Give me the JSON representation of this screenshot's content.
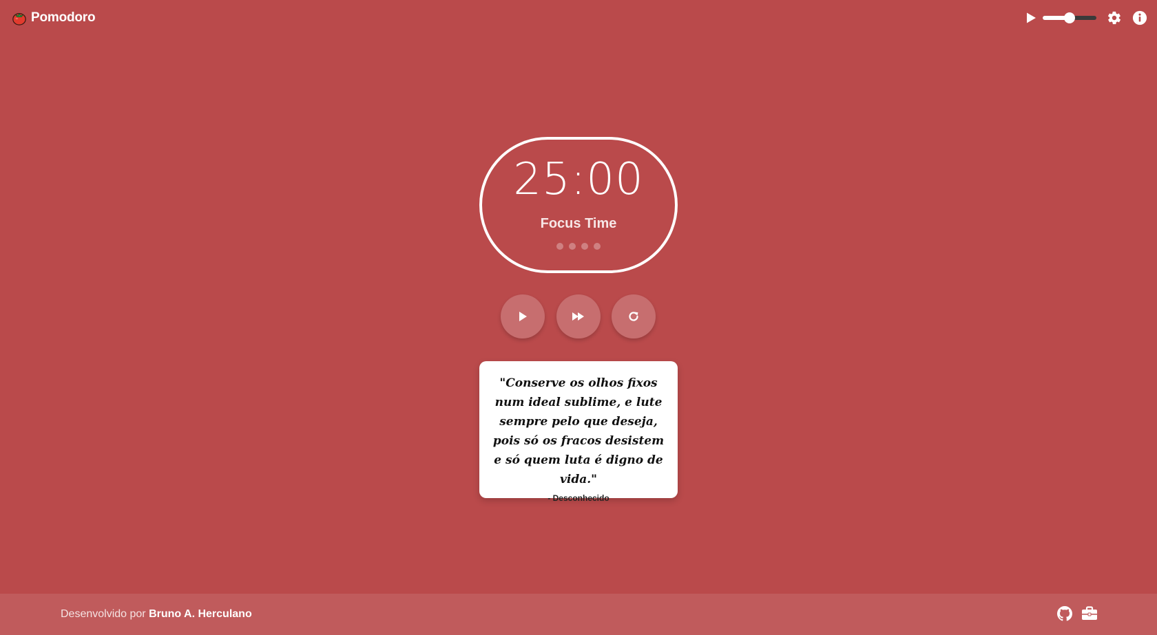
{
  "header": {
    "brand_name": "Pomodoro",
    "logo_icon": "tomato-icon",
    "music_play_icon": "play-icon",
    "volume_level": 0.5,
    "settings_icon": "gear-icon",
    "info_icon": "info-icon"
  },
  "timer": {
    "time": "25:00",
    "mode_label": "Focus Time",
    "cycle_dots_total": 4,
    "cycle_dots_completed": 0
  },
  "controls": {
    "start_icon": "play-icon",
    "skip_icon": "fast-forward-icon",
    "reset_icon": "reset-icon"
  },
  "quote": {
    "text": "\"Conserve os olhos fixos num ideal sublime, e lute sempre pelo que deseja, pois só os fracos desistem e só quem luta é digno de vida.\"",
    "author": "- Desconhecido"
  },
  "footer": {
    "credit_prefix": "Desenvolvido por",
    "credit_name": "Bruno A. Herculano",
    "github_icon": "github-icon",
    "portfolio_icon": "briefcase-icon"
  },
  "colors": {
    "background": "#ba4a4b",
    "footer_background": "#c05b5c",
    "accent": "#ffffff"
  }
}
